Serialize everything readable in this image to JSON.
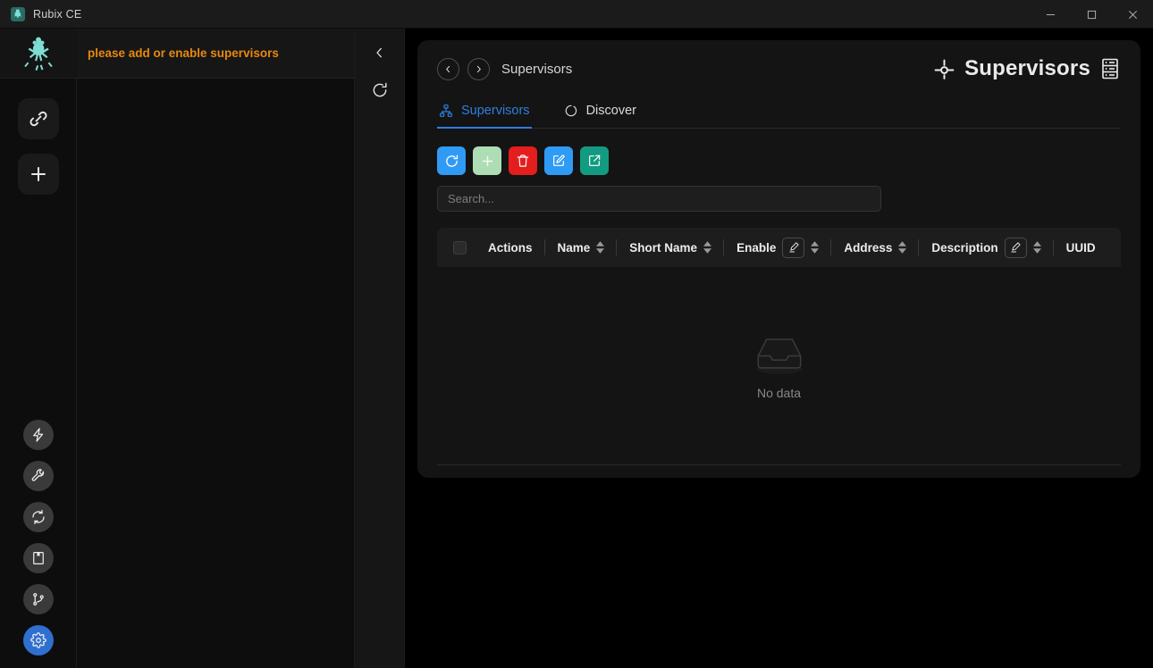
{
  "window": {
    "app_title": "Rubix CE",
    "logo_icon": "frog-icon",
    "controls": {
      "minimize": "minimize-icon",
      "maximize": "maximize-icon",
      "close": "close-icon"
    }
  },
  "rail": {
    "logo_icon": "frog-logo",
    "top_items": [
      {
        "icon": "link-icon",
        "name": "connections"
      },
      {
        "icon": "plus-icon",
        "name": "add"
      }
    ],
    "bottom_items": [
      {
        "icon": "lightning-icon",
        "name": "flow",
        "active": false
      },
      {
        "icon": "wrench-icon",
        "name": "tools",
        "active": false
      },
      {
        "icon": "sync-icon",
        "name": "sync",
        "active": false
      },
      {
        "icon": "book-icon",
        "name": "logs",
        "active": false
      },
      {
        "icon": "git-branch-icon",
        "name": "branches",
        "active": false
      },
      {
        "icon": "gear-icon",
        "name": "settings",
        "active": true
      }
    ]
  },
  "nav_panel": {
    "banner_text": "please add or enable supervisors",
    "banner_color": "#e8880f"
  },
  "panel_controls": [
    {
      "icon": "chevron-left-icon",
      "name": "collapse-panel"
    },
    {
      "icon": "refresh-icon",
      "name": "refresh-panel"
    }
  ],
  "main": {
    "breadcrumb": {
      "back_icon": "chevron-left-circle-icon",
      "forward_icon": "chevron-right-circle-icon",
      "label": "Supervisors"
    },
    "page_title": {
      "left_icon": "crosshair-icon",
      "text": "Supervisors",
      "right_icon": "server-rack-icon"
    },
    "tabs": [
      {
        "label": "Supervisors",
        "icon": "sitemap-icon",
        "active": true
      },
      {
        "label": "Discover",
        "icon": "loading-circle-icon",
        "active": false
      }
    ],
    "toolbar": [
      {
        "name": "refresh-button",
        "icon": "refresh-icon",
        "color": "#2f9bf5",
        "style": "blue"
      },
      {
        "name": "add-button",
        "icon": "plus-icon",
        "color": "#aedcb4",
        "style": "green"
      },
      {
        "name": "delete-button",
        "icon": "trash-icon",
        "color": "#e41d1d",
        "style": "red"
      },
      {
        "name": "edit-button",
        "icon": "edit-square-icon",
        "color": "#2f9bf5",
        "style": "blue2"
      },
      {
        "name": "export-button",
        "icon": "export-square-icon",
        "color": "#129b80",
        "style": "teal"
      }
    ],
    "search": {
      "placeholder": "Search...",
      "value": ""
    },
    "table": {
      "columns": [
        {
          "label": "",
          "name": "select-all",
          "type": "checkbox",
          "sortable": false,
          "filterable": false,
          "divider": false
        },
        {
          "label": "Actions",
          "name": "actions",
          "type": "text",
          "sortable": false,
          "filterable": false,
          "divider": true
        },
        {
          "label": "Name",
          "name": "name",
          "type": "text",
          "sortable": true,
          "filterable": false,
          "divider": true
        },
        {
          "label": "Short Name",
          "name": "short-name",
          "type": "text",
          "sortable": true,
          "filterable": false,
          "divider": true
        },
        {
          "label": "Enable",
          "name": "enable",
          "type": "text",
          "sortable": true,
          "filterable": true,
          "divider": true
        },
        {
          "label": "Address",
          "name": "address",
          "type": "text",
          "sortable": true,
          "filterable": false,
          "divider": true
        },
        {
          "label": "Description",
          "name": "description",
          "type": "text",
          "sortable": true,
          "filterable": true,
          "divider": true
        },
        {
          "label": "UUID",
          "name": "uuid",
          "type": "text",
          "sortable": false,
          "filterable": false,
          "divider": false
        }
      ],
      "rows": [],
      "empty_text": "No data",
      "empty_icon": "inbox-icon"
    }
  }
}
